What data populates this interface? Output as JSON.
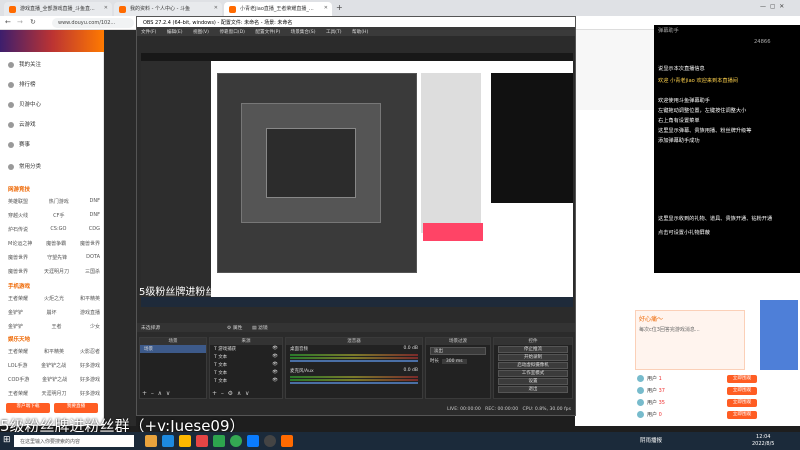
{
  "browser": {
    "tabs": [
      {
        "label": "游戏直播_全部游戏直播_斗鱼直..."
      },
      {
        "label": "我的资料 - 个人中心 - 斗鱼"
      },
      {
        "label": "小青老jiao直播_王者荣耀直播_..."
      }
    ],
    "url": "www.douyu.com/102..."
  },
  "leftnav": {
    "items": [
      "我的关注",
      "排行榜",
      "贝游中心",
      "云游戏",
      "赛事"
    ],
    "section_common": "常用分类",
    "section_hot": "网游竞技",
    "grid_rows": [
      [
        "英雄联盟",
        "热门游戏",
        "DNF"
      ],
      [
        "穿越火线",
        "CF手",
        "DNF"
      ],
      [
        "炉石传说",
        "CS:GO",
        "CDG"
      ],
      [
        "M论运之神",
        "魔兽争霸",
        "魔兽世界"
      ],
      [
        "魔兽世界",
        "守望先锋",
        "DOTA"
      ],
      [
        "魔兽世界",
        "天涯明月刀",
        "三国杀"
      ]
    ],
    "section_mobile": "手机游戏",
    "grid_rows2": [
      [
        "王者荣耀",
        "火炬之光",
        "和平精英"
      ],
      [
        "金铲铲",
        "崩坏",
        "游戏直播"
      ],
      [
        "金铲铲",
        "王者",
        "少女"
      ]
    ],
    "section_ent": "娱乐天地",
    "grid_rows3": [
      [
        "王者荣耀",
        "和平精英",
        "火影忍者"
      ],
      [
        "LOL手游",
        "金铲铲之战",
        "好多游戏"
      ],
      [
        "COD手游",
        "金铲铲之战",
        "好多游戏"
      ],
      [
        "王者荣耀",
        "天涯明月刀",
        "好多游戏"
      ]
    ],
    "btn_follow": "客户端下载",
    "btn_live": "我要直播"
  },
  "obs": {
    "title": "OBS 27.2.4 (64-bit, windows) - 配置文件: 未命名 - 场景: 未命名",
    "menu": [
      "文件(F)",
      "编辑(E)",
      "视图(V)",
      "停靠窗口(D)",
      "配置文件(P)",
      "场景集合(S)",
      "工具(T)",
      "帮助(H)"
    ],
    "overlay_text": "5级粉丝牌进粉丝群（+v:Juese09）",
    "scene_label": "未选择源",
    "props_btn": "属性",
    "filters_btn": "滤镜",
    "scenes_header": "场景",
    "scenes": [
      "场景"
    ],
    "sources_header": "来源",
    "sources": [
      "游戏捕获",
      "文本",
      "文本",
      "文本",
      "文本"
    ],
    "mixer_header": "混音器",
    "mixer_tracks": [
      {
        "name": "桌面音频",
        "db": "0.0 dB"
      },
      {
        "name": "麦克风/Aux",
        "db": "0.0 dB"
      }
    ],
    "transition_header": "场景过渡",
    "transition": "淡出",
    "duration_label": "时长",
    "duration": "300 ms",
    "controls_header": "控件",
    "controls": [
      "停止推流",
      "开始录制",
      "启动虚拟摄像机",
      "工作室模式",
      "设置",
      "退出"
    ],
    "status": {
      "live_label": "LIVE:",
      "live_time": "00:00:00",
      "rec_label": "REC:",
      "rec_time": "00:00:00",
      "cpu": "CPU: 0.8%, 30.00 fps"
    }
  },
  "chat": {
    "header": "弹幕助手",
    "lines": [
      "说显示本次直播信息",
      "欢迎 小青老jiao 欢迎来到本直播间",
      "欢迎使用斗鱼弹幕助手",
      "左键拖动调整位置，左键按住调整大小",
      "右上角有设置菜单",
      "这里显示弹幕、贵族用播、粉丝牌升级等",
      "添加弹幕助手成功",
      "这里显示收到的礼物、道具、贵族开通、钻粉开通",
      "点击可设置小礼物屏蔽"
    ],
    "counter": "24866"
  },
  "right_panel": {
    "title": "好心痛～",
    "subtitle": "每次c位3回答完游戏消息...",
    "items": [
      {
        "name": "用户",
        "val": "1",
        "btn": "立即围观"
      },
      {
        "name": "用户",
        "val": "37",
        "btn": "立即围观"
      },
      {
        "name": "用户",
        "val": "35",
        "btn": "立即围观"
      },
      {
        "name": "用户",
        "val": "0",
        "btn": "立即围观"
      }
    ]
  },
  "subtitle_text": "5级粉丝牌进粉丝群（+v:Juese09）",
  "taskbar": {
    "search_placeholder": "在这里输入你要搜索的内容",
    "weather": "阴雨播报",
    "time": "12:04",
    "date": "2022/8/5"
  },
  "colors": {
    "douyu_orange": "#ff5d23",
    "obs_dark": "#2b2b2b",
    "taskbar": "#1b2a3a"
  }
}
